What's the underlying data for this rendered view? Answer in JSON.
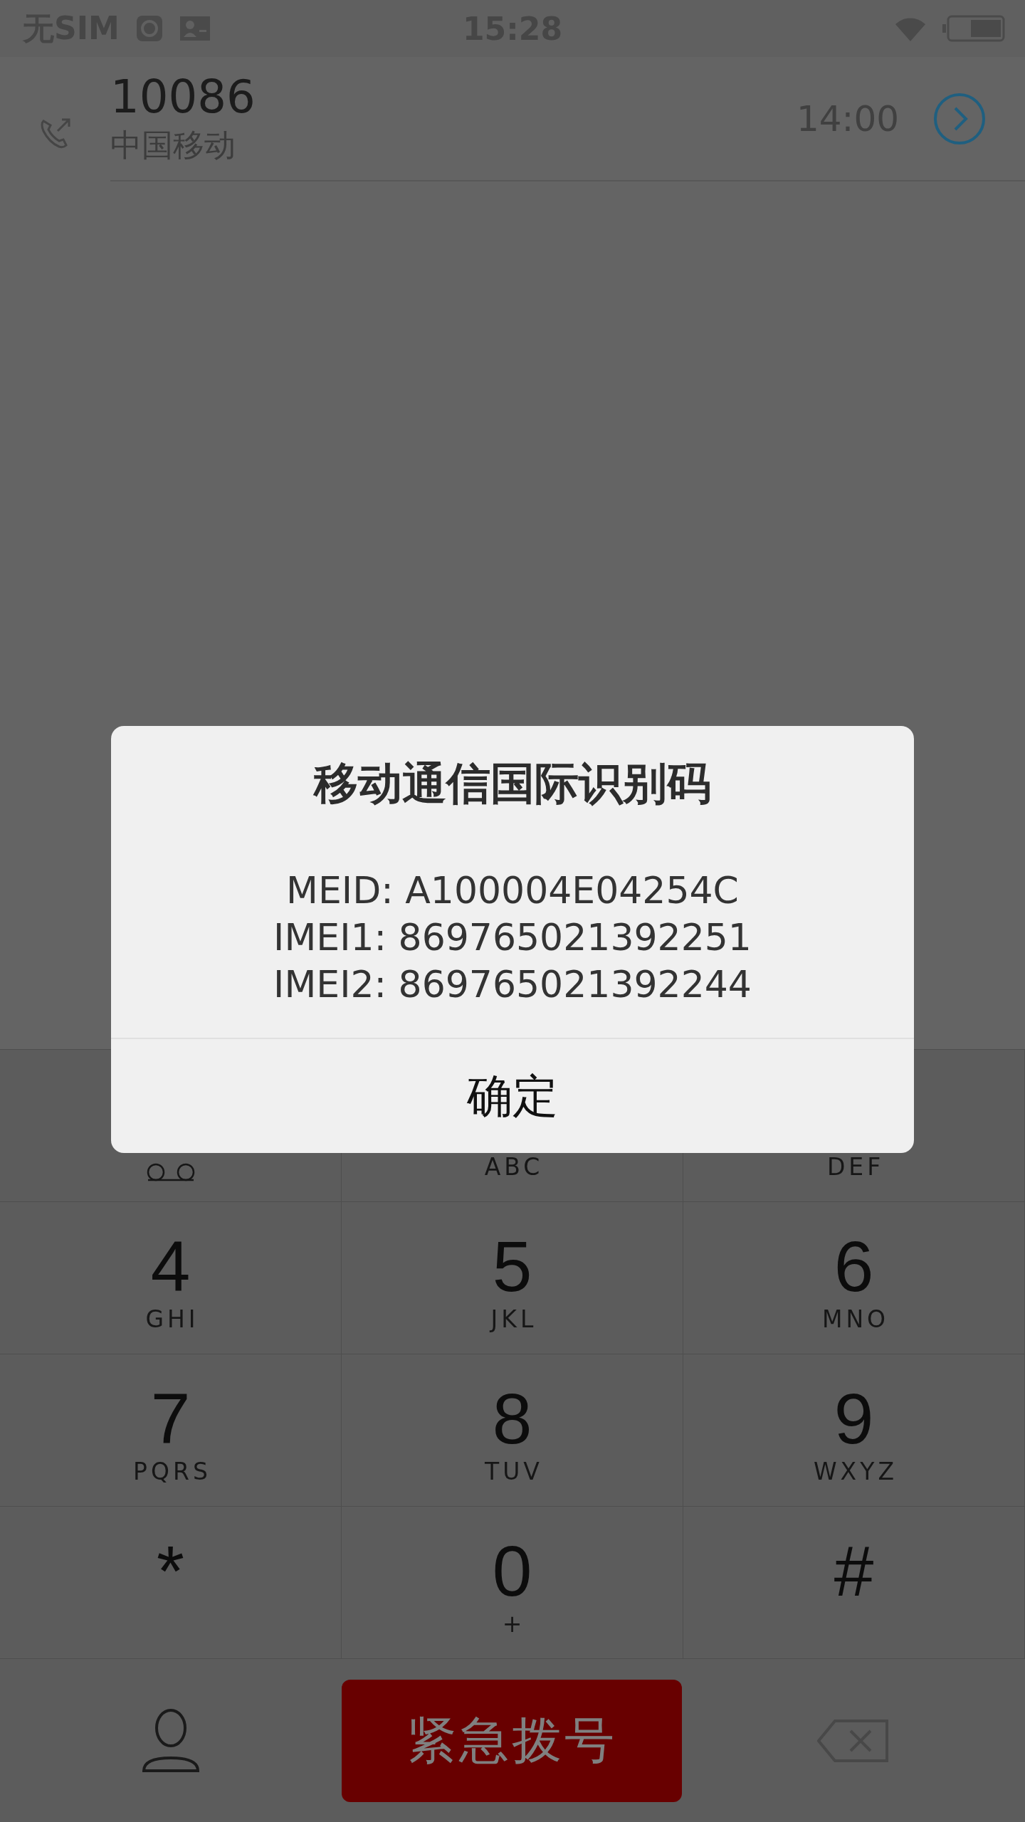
{
  "status_bar": {
    "carrier": "无SIM",
    "time": "15:28"
  },
  "call_log": [
    {
      "number": "10086",
      "name": "中国移动",
      "time": "14:00"
    }
  ],
  "dialog": {
    "title": "移动通信国际识别码",
    "lines": [
      "MEID: A100004E04254C",
      "IMEI1: 869765021392251",
      "IMEI2: 869765021392244"
    ],
    "button": "确定"
  },
  "keypad": [
    {
      "kind": "voicemail"
    },
    {
      "kind": "letters",
      "letters": "ABC"
    },
    {
      "kind": "letters",
      "letters": "DEF"
    },
    {
      "kind": "digit",
      "digit": "4",
      "letters": "GHI"
    },
    {
      "kind": "digit",
      "digit": "5",
      "letters": "JKL"
    },
    {
      "kind": "digit",
      "digit": "6",
      "letters": "MNO"
    },
    {
      "kind": "digit",
      "digit": "7",
      "letters": "PQRS"
    },
    {
      "kind": "digit",
      "digit": "8",
      "letters": "TUV"
    },
    {
      "kind": "digit",
      "digit": "9",
      "letters": "WXYZ"
    },
    {
      "kind": "digit",
      "digit": "*"
    },
    {
      "kind": "digit",
      "digit": "0",
      "letters": "+"
    },
    {
      "kind": "digit",
      "digit": "#"
    }
  ],
  "emergency_button": "紧急拨号"
}
